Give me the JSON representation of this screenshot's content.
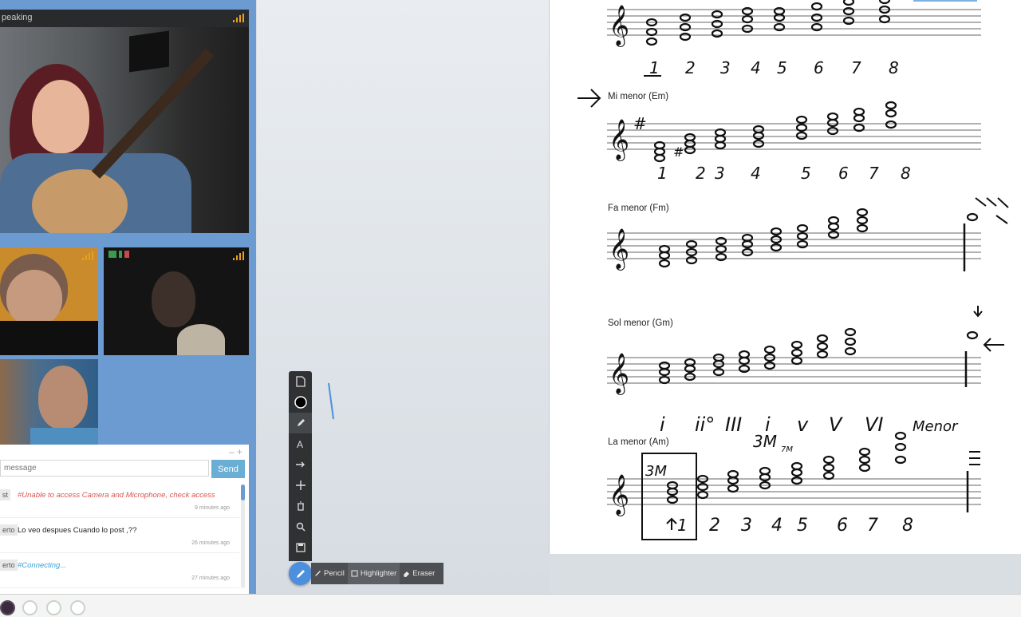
{
  "video": {
    "speaking_label": "peaking",
    "signal_color": "#e9a020"
  },
  "chat": {
    "tools": "– +",
    "input_placeholder": "message",
    "send_label": "Send",
    "messages": [
      {
        "sender": "st",
        "text": "#Unable to access Camera and Microphone, check access",
        "time": "9 minutes ago",
        "color": "#d9534f"
      },
      {
        "sender": "erto",
        "text": "Lo veo despues Cuando lo post ,??",
        "time": "26 minutes ago",
        "color": "#222222"
      },
      {
        "sender": "erto",
        "text": "#Connecting...",
        "time": "27 minutes ago",
        "color": "#3a9fd6"
      }
    ]
  },
  "toolbar": {
    "tools": [
      "new-page-icon",
      "color-picker-icon",
      "pencil-icon",
      "text-icon",
      "arrow-icon",
      "move-icon",
      "delete-icon",
      "zoom-icon",
      "save-icon"
    ],
    "active": "pencil-icon",
    "accent": "#4c8fdc",
    "sub_tools": [
      {
        "label": "Pencil",
        "icon": "pencil-icon"
      },
      {
        "label": "Highlighter",
        "icon": "highlighter-icon"
      },
      {
        "label": "Eraser",
        "icon": "eraser-icon"
      }
    ]
  },
  "sheet": {
    "sections": [
      {
        "title": "Mi menor (Em)"
      },
      {
        "title": "Fa menor (Fm)"
      },
      {
        "title": "Sol menor (Gm)"
      },
      {
        "title": "La menor (Am)"
      }
    ],
    "numbers_row1": [
      "1",
      "2",
      "3",
      "4",
      "5",
      "6",
      "7",
      "8"
    ],
    "numbers_row2": [
      "1",
      "2",
      "3",
      "4",
      "5",
      "6",
      "7",
      "8"
    ],
    "numbers_row5": [
      "1",
      "2",
      "3",
      "4",
      "5",
      "6",
      "7",
      "8"
    ],
    "roman_numerals": [
      "i",
      "ii°",
      "III",
      "i",
      "v",
      "V",
      "VI",
      "Menor"
    ],
    "annotation_3M": "3M",
    "annotation_7M": "7M"
  },
  "participants": {
    "count": 4
  }
}
